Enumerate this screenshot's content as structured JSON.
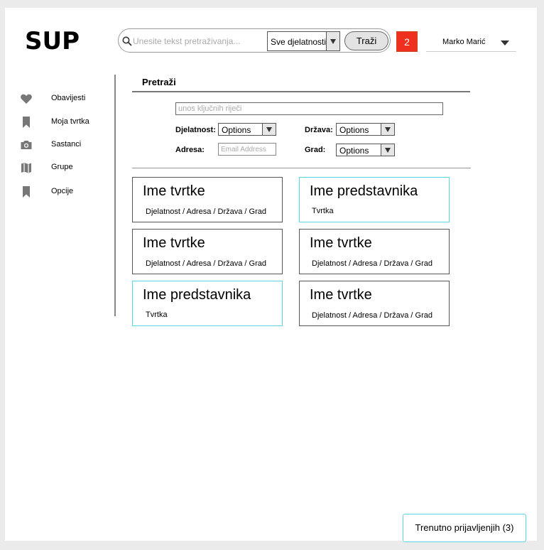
{
  "app": {
    "logo": "SUP"
  },
  "search": {
    "placeholder": "Unesite tekst pretraživanja...",
    "category_selected": "Sve djelatnosti",
    "button_label": "Traži"
  },
  "notifications": {
    "count": "2"
  },
  "user": {
    "name": "Marko Marić"
  },
  "sidebar": {
    "items": [
      {
        "label": "Obavijesti",
        "icon": "heart-icon"
      },
      {
        "label": "Moja tvrtka",
        "icon": "bookmark-icon"
      },
      {
        "label": "Sastanci",
        "icon": "camera-icon"
      },
      {
        "label": "Grupe",
        "icon": "map-icon"
      },
      {
        "label": "Opcije",
        "icon": "bookmark-icon"
      }
    ]
  },
  "filters": {
    "title": "Pretraži",
    "keywords_placeholder": "unos ključnih riječi",
    "djelatnost_label": "Djelatnost:",
    "djelatnost_value": "Options",
    "drzava_label": "Država:",
    "drzava_value": "Options",
    "adresa_label": "Adresa:",
    "adresa_placeholder": "Email Address",
    "grad_label": "Grad:",
    "grad_value": "Options"
  },
  "results": [
    {
      "title": "Ime tvrtke",
      "subtitle": "Djelatnost / Adresa / Država / Grad",
      "type": "company"
    },
    {
      "title": "Ime predstavnika",
      "subtitle": "Tvrtka",
      "type": "representative"
    },
    {
      "title": "Ime tvrtke",
      "subtitle": "Djelatnost / Adresa / Država / Grad",
      "type": "company"
    },
    {
      "title": "Ime tvrtke",
      "subtitle": "Djelatnost / Adresa / Država / Grad",
      "type": "company"
    },
    {
      "title": "Ime predstavnika",
      "subtitle": "Tvrtka",
      "type": "representative"
    },
    {
      "title": "Ime tvrtke",
      "subtitle": "Djelatnost / Adresa / Država / Grad",
      "type": "company"
    }
  ],
  "footer": {
    "online_label": "Trenutno prijavljenjih (3)"
  },
  "colors": {
    "badge": "#f0301e",
    "representative_border": "#5fd6e6",
    "icons": "#777777"
  }
}
